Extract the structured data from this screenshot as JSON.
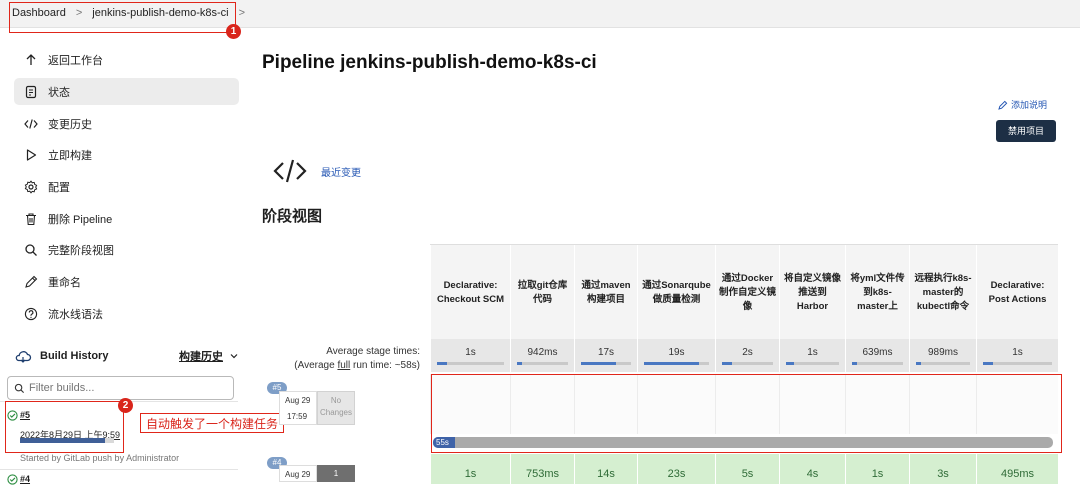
{
  "breadcrumb": {
    "root": "Dashboard",
    "job": "jenkins-publish-demo-k8s-ci",
    "sep": ">"
  },
  "badges": {
    "one": "1",
    "two": "2"
  },
  "sidebar": {
    "items": [
      {
        "label": "返回工作台",
        "icon": "arrow-up-icon"
      },
      {
        "label": "状态",
        "icon": "document-icon"
      },
      {
        "label": "变更历史",
        "icon": "code-icon"
      },
      {
        "label": "立即构建",
        "icon": "play-icon"
      },
      {
        "label": "配置",
        "icon": "gear-icon"
      },
      {
        "label": "删除 Pipeline",
        "icon": "trash-icon"
      },
      {
        "label": "完整阶段视图",
        "icon": "search-icon"
      },
      {
        "label": "重命名",
        "icon": "pencil-icon"
      },
      {
        "label": "流水线语法",
        "icon": "help-icon"
      }
    ],
    "build_history": {
      "title": "Build History",
      "link": "构建历史"
    },
    "filter_placeholder": "Filter builds...",
    "builds": [
      {
        "number": "#5",
        "date": "2022年8月29日 上午9:59",
        "by": "Started by GitLab push by Administrator",
        "progress": 0.9
      },
      {
        "number": "#4"
      }
    ]
  },
  "annotation": "自动触发了一个构建任务",
  "main": {
    "title": "Pipeline jenkins-publish-demo-k8s-ci",
    "add_description": "添加说明",
    "disable_button": "禁用项目",
    "recent_changes": "最近变更",
    "stage_view_title": "阶段视图",
    "avg_label_1": "Average stage times:",
    "avg_label_2a": "(Average ",
    "avg_label_2b": "full",
    "avg_label_2c": " run time: ~58s)",
    "stages": [
      {
        "name": "Declarative: Checkout SCM",
        "avg": "1s",
        "avg_fill": 0.15
      },
      {
        "name": "拉取git仓库代码",
        "avg": "942ms",
        "avg_fill": 0.1
      },
      {
        "name": "通过maven构建项目",
        "avg": "17s",
        "avg_fill": 0.7
      },
      {
        "name": "通过Sonarqube做质量检测",
        "avg": "19s",
        "avg_fill": 0.85
      },
      {
        "name": "通过Docker制作自定义镜像",
        "avg": "2s",
        "avg_fill": 0.2
      },
      {
        "name": "将自定义镜像推送到Harbor",
        "avg": "1s",
        "avg_fill": 0.15
      },
      {
        "name": "将yml文件传到k8s-master上",
        "avg": "639ms",
        "avg_fill": 0.1
      },
      {
        "name": "远程执行k8s-master的kubectl命令",
        "avg": "989ms",
        "avg_fill": 0.1
      },
      {
        "name": "Declarative: Post Actions",
        "avg": "1s",
        "avg_fill": 0.15
      }
    ],
    "runs": [
      {
        "badge": "#5",
        "date": "Aug 29",
        "time": "17:59",
        "changes": "No Changes",
        "elapsed": "55s",
        "cells": [
          "",
          "",
          "",
          "",
          "",
          "",
          "",
          "",
          ""
        ]
      },
      {
        "badge": "#4",
        "date": "Aug 29",
        "changes": "1",
        "cells": [
          "1s",
          "753ms",
          "14s",
          "23s",
          "5s",
          "4s",
          "1s",
          "3s",
          "495ms"
        ]
      }
    ]
  },
  "colors": {
    "accent": "#2456b3",
    "annotation": "#e0261a",
    "success": "#d5efd0",
    "button": "#1d2f45"
  }
}
